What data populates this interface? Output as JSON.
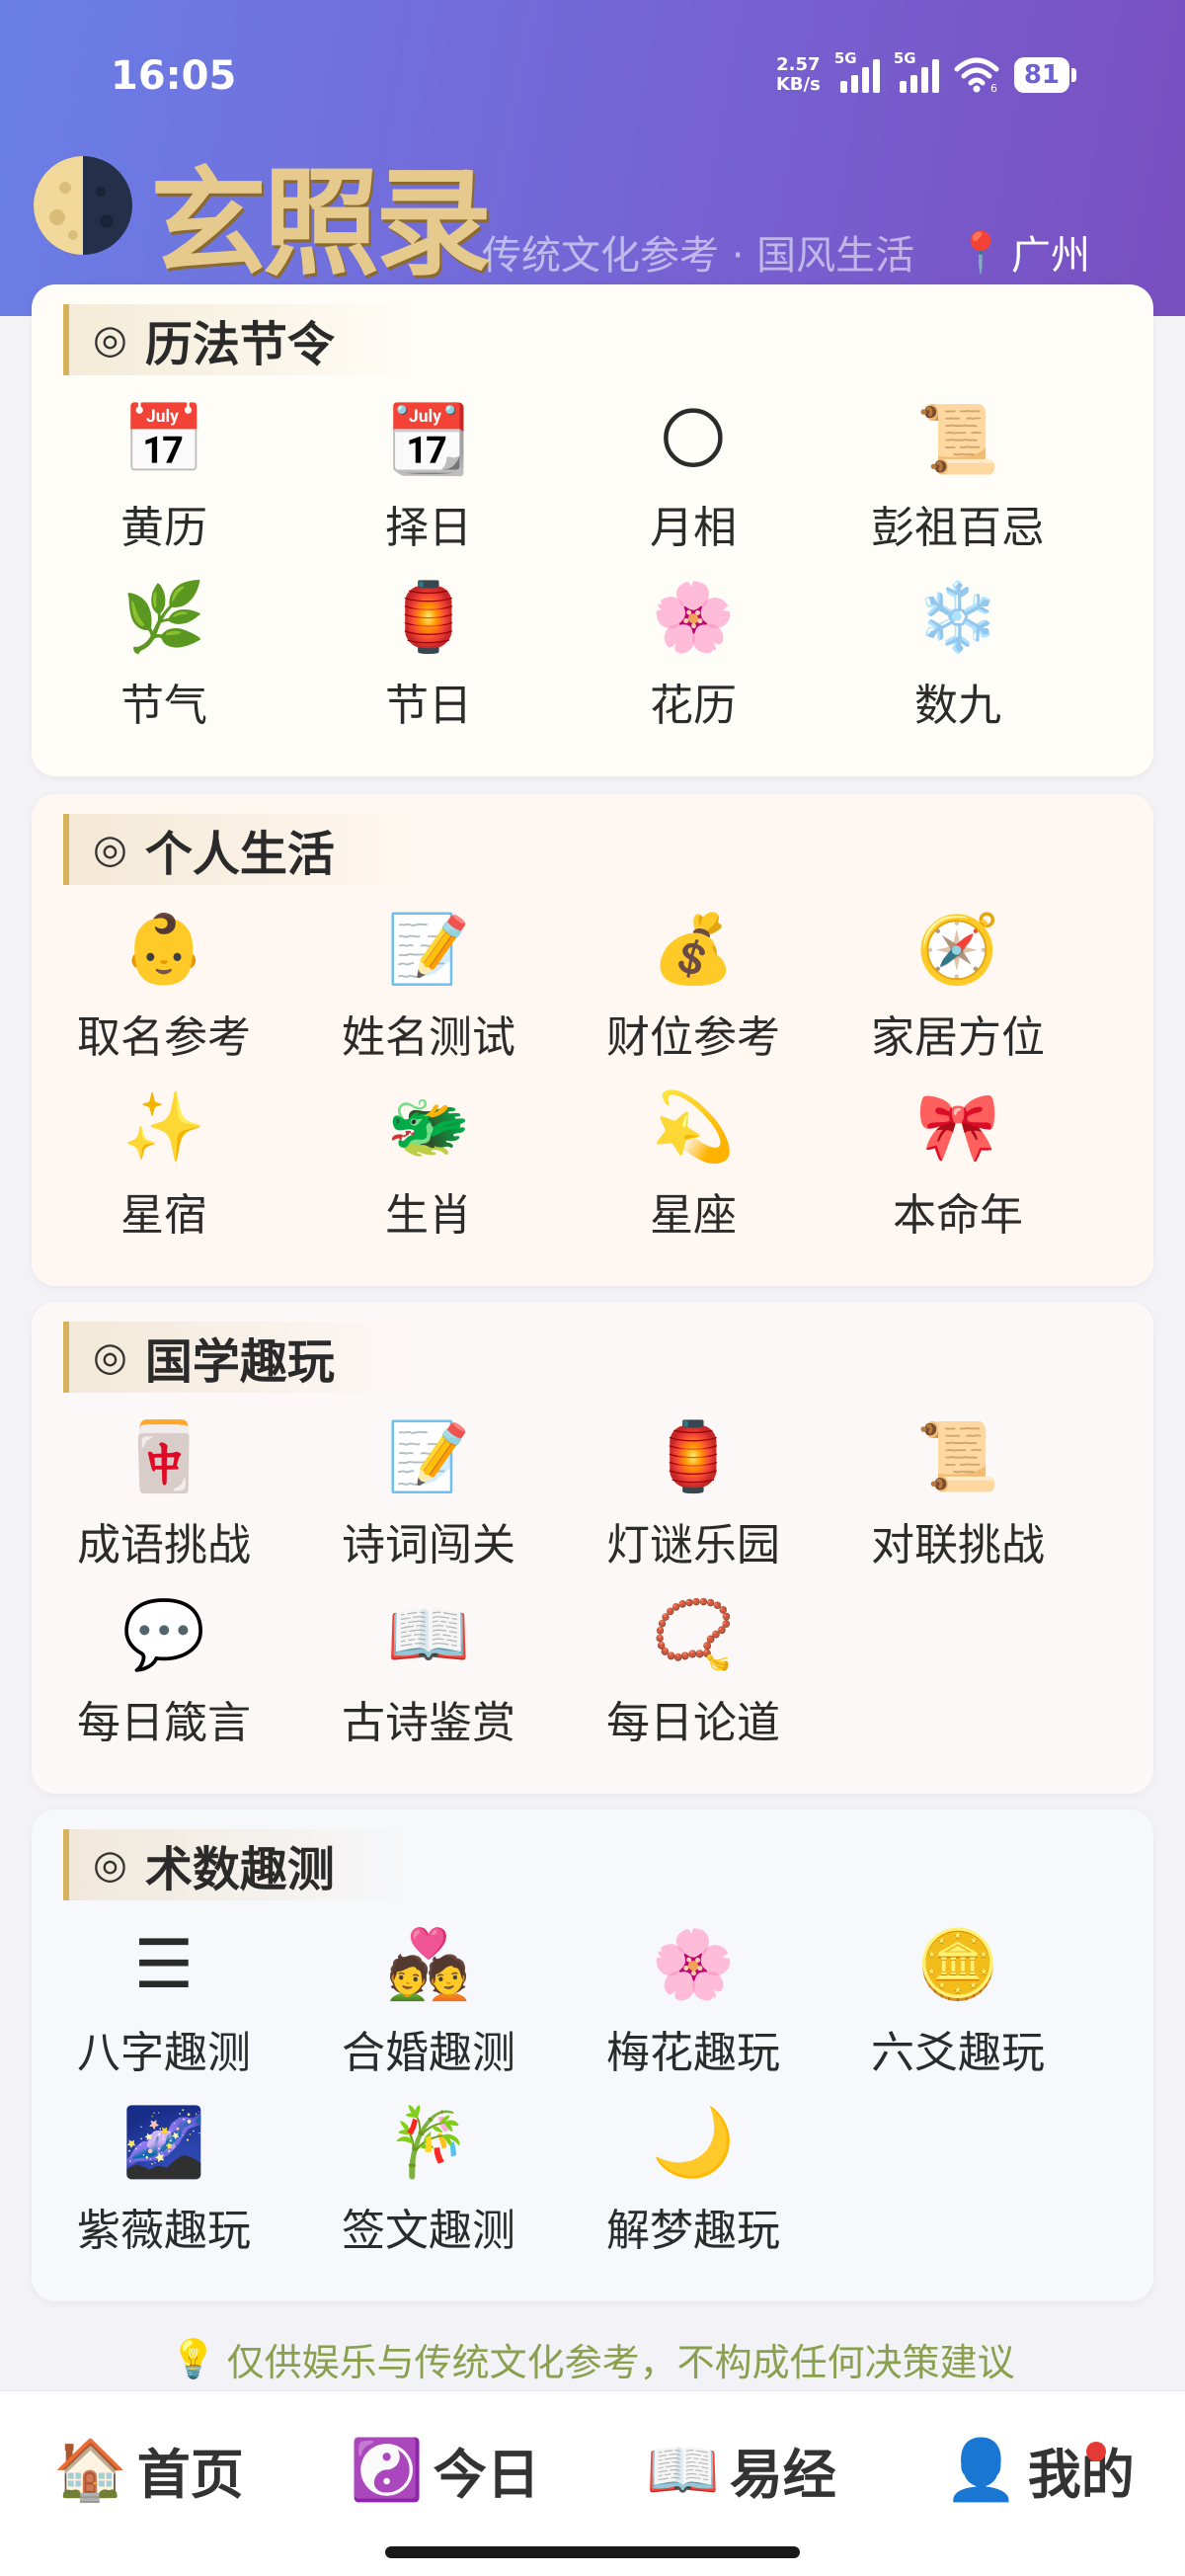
{
  "status_bar": {
    "time": "16:05",
    "net_speed_value": "2.57",
    "net_speed_unit": "KB/s",
    "signal1_tag": "5G",
    "signal2_tag": "5G",
    "wifi_badge": "6",
    "battery": "81"
  },
  "header": {
    "brand": "玄照录",
    "slogan": "传统文化参考 · 国风生活",
    "location_icon": "📍",
    "location": "广州"
  },
  "sections": [
    {
      "title": "历法节令",
      "ring": "◎",
      "items": [
        {
          "icon": "📅",
          "icon_name": "calendar-icon",
          "label": "黄历"
        },
        {
          "icon": "📆",
          "icon_name": "date-calendar-icon",
          "label": "择日"
        },
        {
          "icon": "🌕",
          "icon_name": "full-moon-icon",
          "label": "月相"
        },
        {
          "icon": "📜",
          "icon_name": "scroll-icon",
          "label": "彭祖百忌"
        },
        {
          "icon": "🌿",
          "icon_name": "herb-icon",
          "label": "节气"
        },
        {
          "icon": "🏮",
          "icon_name": "lantern-icon",
          "label": "节日"
        },
        {
          "icon": "🌸",
          "icon_name": "cherry-blossom-icon",
          "label": "花历"
        },
        {
          "icon": "❄️",
          "icon_name": "snowflake-icon",
          "label": "数九"
        }
      ]
    },
    {
      "title": "个人生活",
      "ring": "◎",
      "items": [
        {
          "icon": "👶",
          "icon_name": "baby-icon",
          "label": "取名参考"
        },
        {
          "icon": "📝",
          "icon_name": "memo-icon",
          "label": "姓名测试"
        },
        {
          "icon": "💰",
          "icon_name": "money-bag-icon",
          "label": "财位参考"
        },
        {
          "icon": "🧭",
          "icon_name": "compass-icon",
          "label": "家居方位"
        },
        {
          "icon": "✨",
          "icon_name": "sparkles-icon",
          "label": "星宿"
        },
        {
          "icon": "🐲",
          "icon_name": "dragon-icon",
          "label": "生肖"
        },
        {
          "icon": "💫",
          "icon_name": "dizzy-star-icon",
          "label": "星座"
        },
        {
          "icon": "🎀",
          "icon_name": "ribbon-icon",
          "label": "本命年"
        }
      ]
    },
    {
      "title": "国学趣玩",
      "ring": "◎",
      "items": [
        {
          "icon": "🀄",
          "icon_name": "mahjong-icon",
          "label": "成语挑战"
        },
        {
          "icon": "📝",
          "icon_name": "memo-icon",
          "label": "诗词闯关"
        },
        {
          "icon": "🏮",
          "icon_name": "lantern-icon",
          "label": "灯谜乐园"
        },
        {
          "icon": "📜",
          "icon_name": "scroll-icon",
          "label": "对联挑战"
        },
        {
          "icon": "💬",
          "icon_name": "speech-bubble-icon",
          "label": "每日箴言"
        },
        {
          "icon": "📖",
          "icon_name": "open-book-icon",
          "label": "古诗鉴赏"
        },
        {
          "icon": "📿",
          "icon_name": "prayer-beads-icon",
          "label": "每日论道"
        }
      ]
    },
    {
      "title": "术数趣测",
      "ring": "◎",
      "items": [
        {
          "icon": "☰",
          "icon_name": "trigram-icon",
          "label": "八字趣测"
        },
        {
          "icon": "💑",
          "icon_name": "couple-icon",
          "label": "合婚趣测"
        },
        {
          "icon": "🌸",
          "icon_name": "plum-blossom-icon",
          "label": "梅花趣玩"
        },
        {
          "icon": "🪙",
          "icon_name": "coin-icon",
          "label": "六爻趣玩"
        },
        {
          "icon": "🌌",
          "icon_name": "milky-way-icon",
          "label": "紫薇趣玩"
        },
        {
          "icon": "🎋",
          "icon_name": "tanabata-tree-icon",
          "label": "签文趣测"
        },
        {
          "icon": "🌙",
          "icon_name": "crescent-moon-icon",
          "label": "解梦趣玩"
        }
      ]
    }
  ],
  "disclaimer": {
    "icon": "💡",
    "text": "仅供娱乐与传统文化参考，不构成任何决策建议"
  },
  "tabbar": {
    "tabs": [
      {
        "icon": "🏠",
        "label": "首页"
      },
      {
        "icon": "☯️",
        "label": "今日"
      },
      {
        "icon": "📖",
        "label": "易经"
      },
      {
        "icon": "👤",
        "label": "我的"
      }
    ]
  },
  "colors": {
    "header_gradient_start": "#6a7fe6",
    "header_gradient_end": "#7a4fc0",
    "brand_gold": "#e6c98c",
    "accent_bar": "#d6b25a",
    "disclaimer_text": "#8aa04e",
    "notification_dot": "#e53935"
  }
}
